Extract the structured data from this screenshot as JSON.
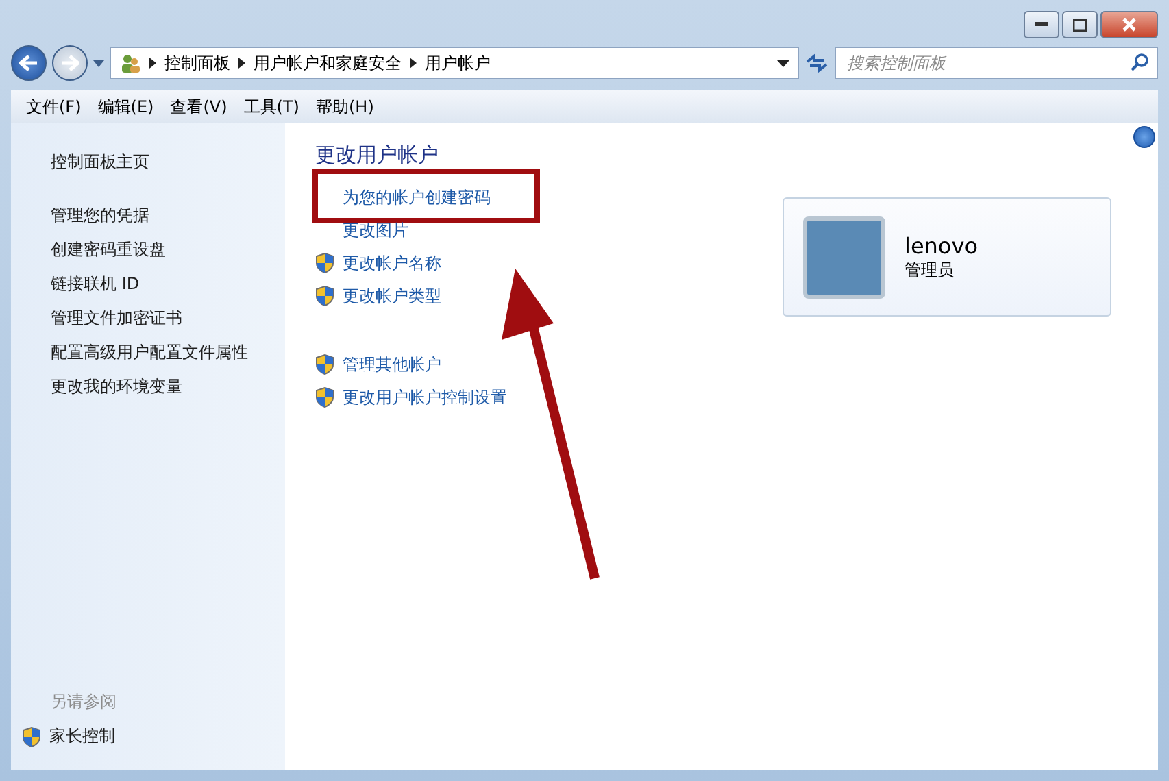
{
  "breadcrumb": [
    "控制面板",
    "用户帐户和家庭安全",
    "用户帐户"
  ],
  "search": {
    "placeholder": "搜索控制面板"
  },
  "menu": [
    "文件(F)",
    "编辑(E)",
    "查看(V)",
    "工具(T)",
    "帮助(H)"
  ],
  "sidebar": {
    "items": [
      "控制面板主页",
      "管理您的凭据",
      "创建密码重设盘",
      "链接联机 ID",
      "管理文件加密证书",
      "配置高级用户配置文件属性",
      "更改我的环境变量"
    ],
    "see_also_heading": "另请参阅",
    "see_also": [
      {
        "label": "家长控制",
        "shield": true
      }
    ]
  },
  "main": {
    "title": "更改用户帐户",
    "groups": [
      [
        {
          "label": "为您的帐户创建密码",
          "shield": false,
          "highlighted": true
        },
        {
          "label": "更改图片",
          "shield": false,
          "highlighted": false
        },
        {
          "label": "更改帐户名称",
          "shield": true,
          "highlighted": false
        },
        {
          "label": "更改帐户类型",
          "shield": true,
          "highlighted": false
        }
      ],
      [
        {
          "label": "管理其他帐户",
          "shield": true,
          "highlighted": false
        },
        {
          "label": "更改用户帐户控制设置",
          "shield": true,
          "highlighted": false
        }
      ]
    ]
  },
  "account": {
    "name": "lenovo",
    "role": "管理员"
  }
}
